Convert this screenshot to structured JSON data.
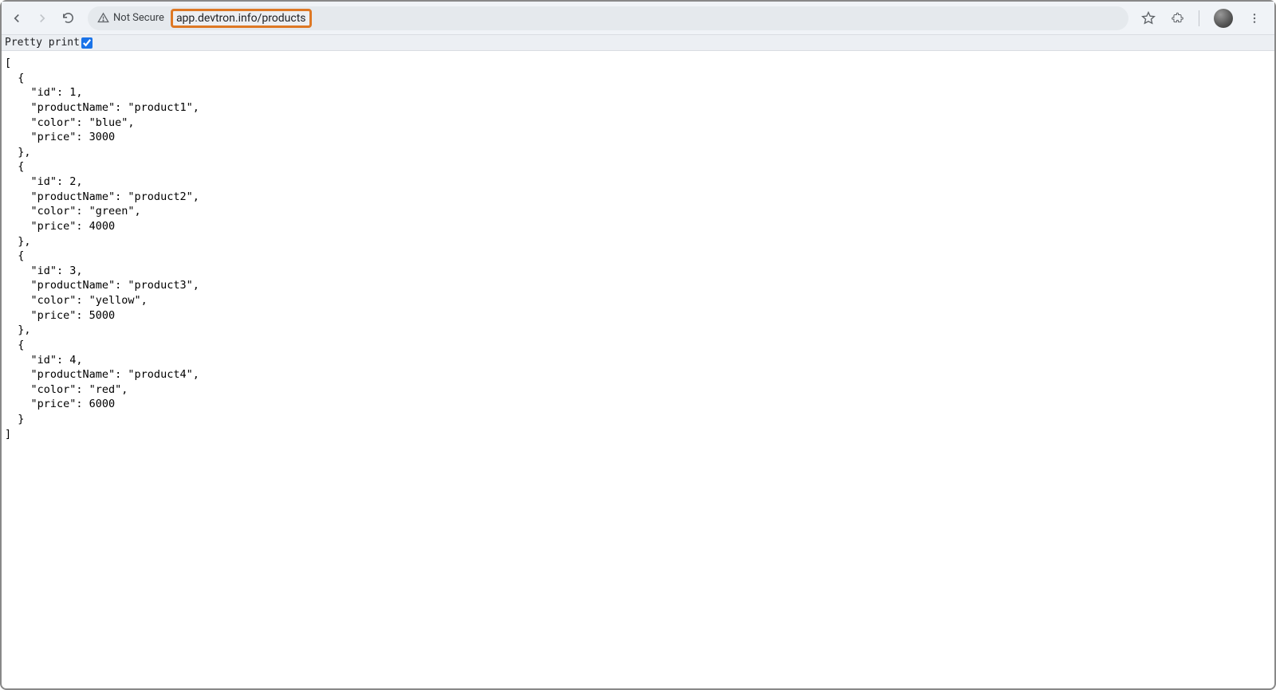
{
  "address_bar": {
    "security_label": "Not Secure",
    "url": "app.devtron.info/products"
  },
  "prettyPrint": {
    "label": "Pretty print",
    "checked": true
  },
  "responseJson": [
    {
      "id": 1,
      "productName": "product1",
      "color": "blue",
      "price": 3000
    },
    {
      "id": 2,
      "productName": "product2",
      "color": "green",
      "price": 4000
    },
    {
      "id": 3,
      "productName": "product3",
      "color": "yellow",
      "price": 5000
    },
    {
      "id": 4,
      "productName": "product4",
      "color": "red",
      "price": 6000
    }
  ]
}
